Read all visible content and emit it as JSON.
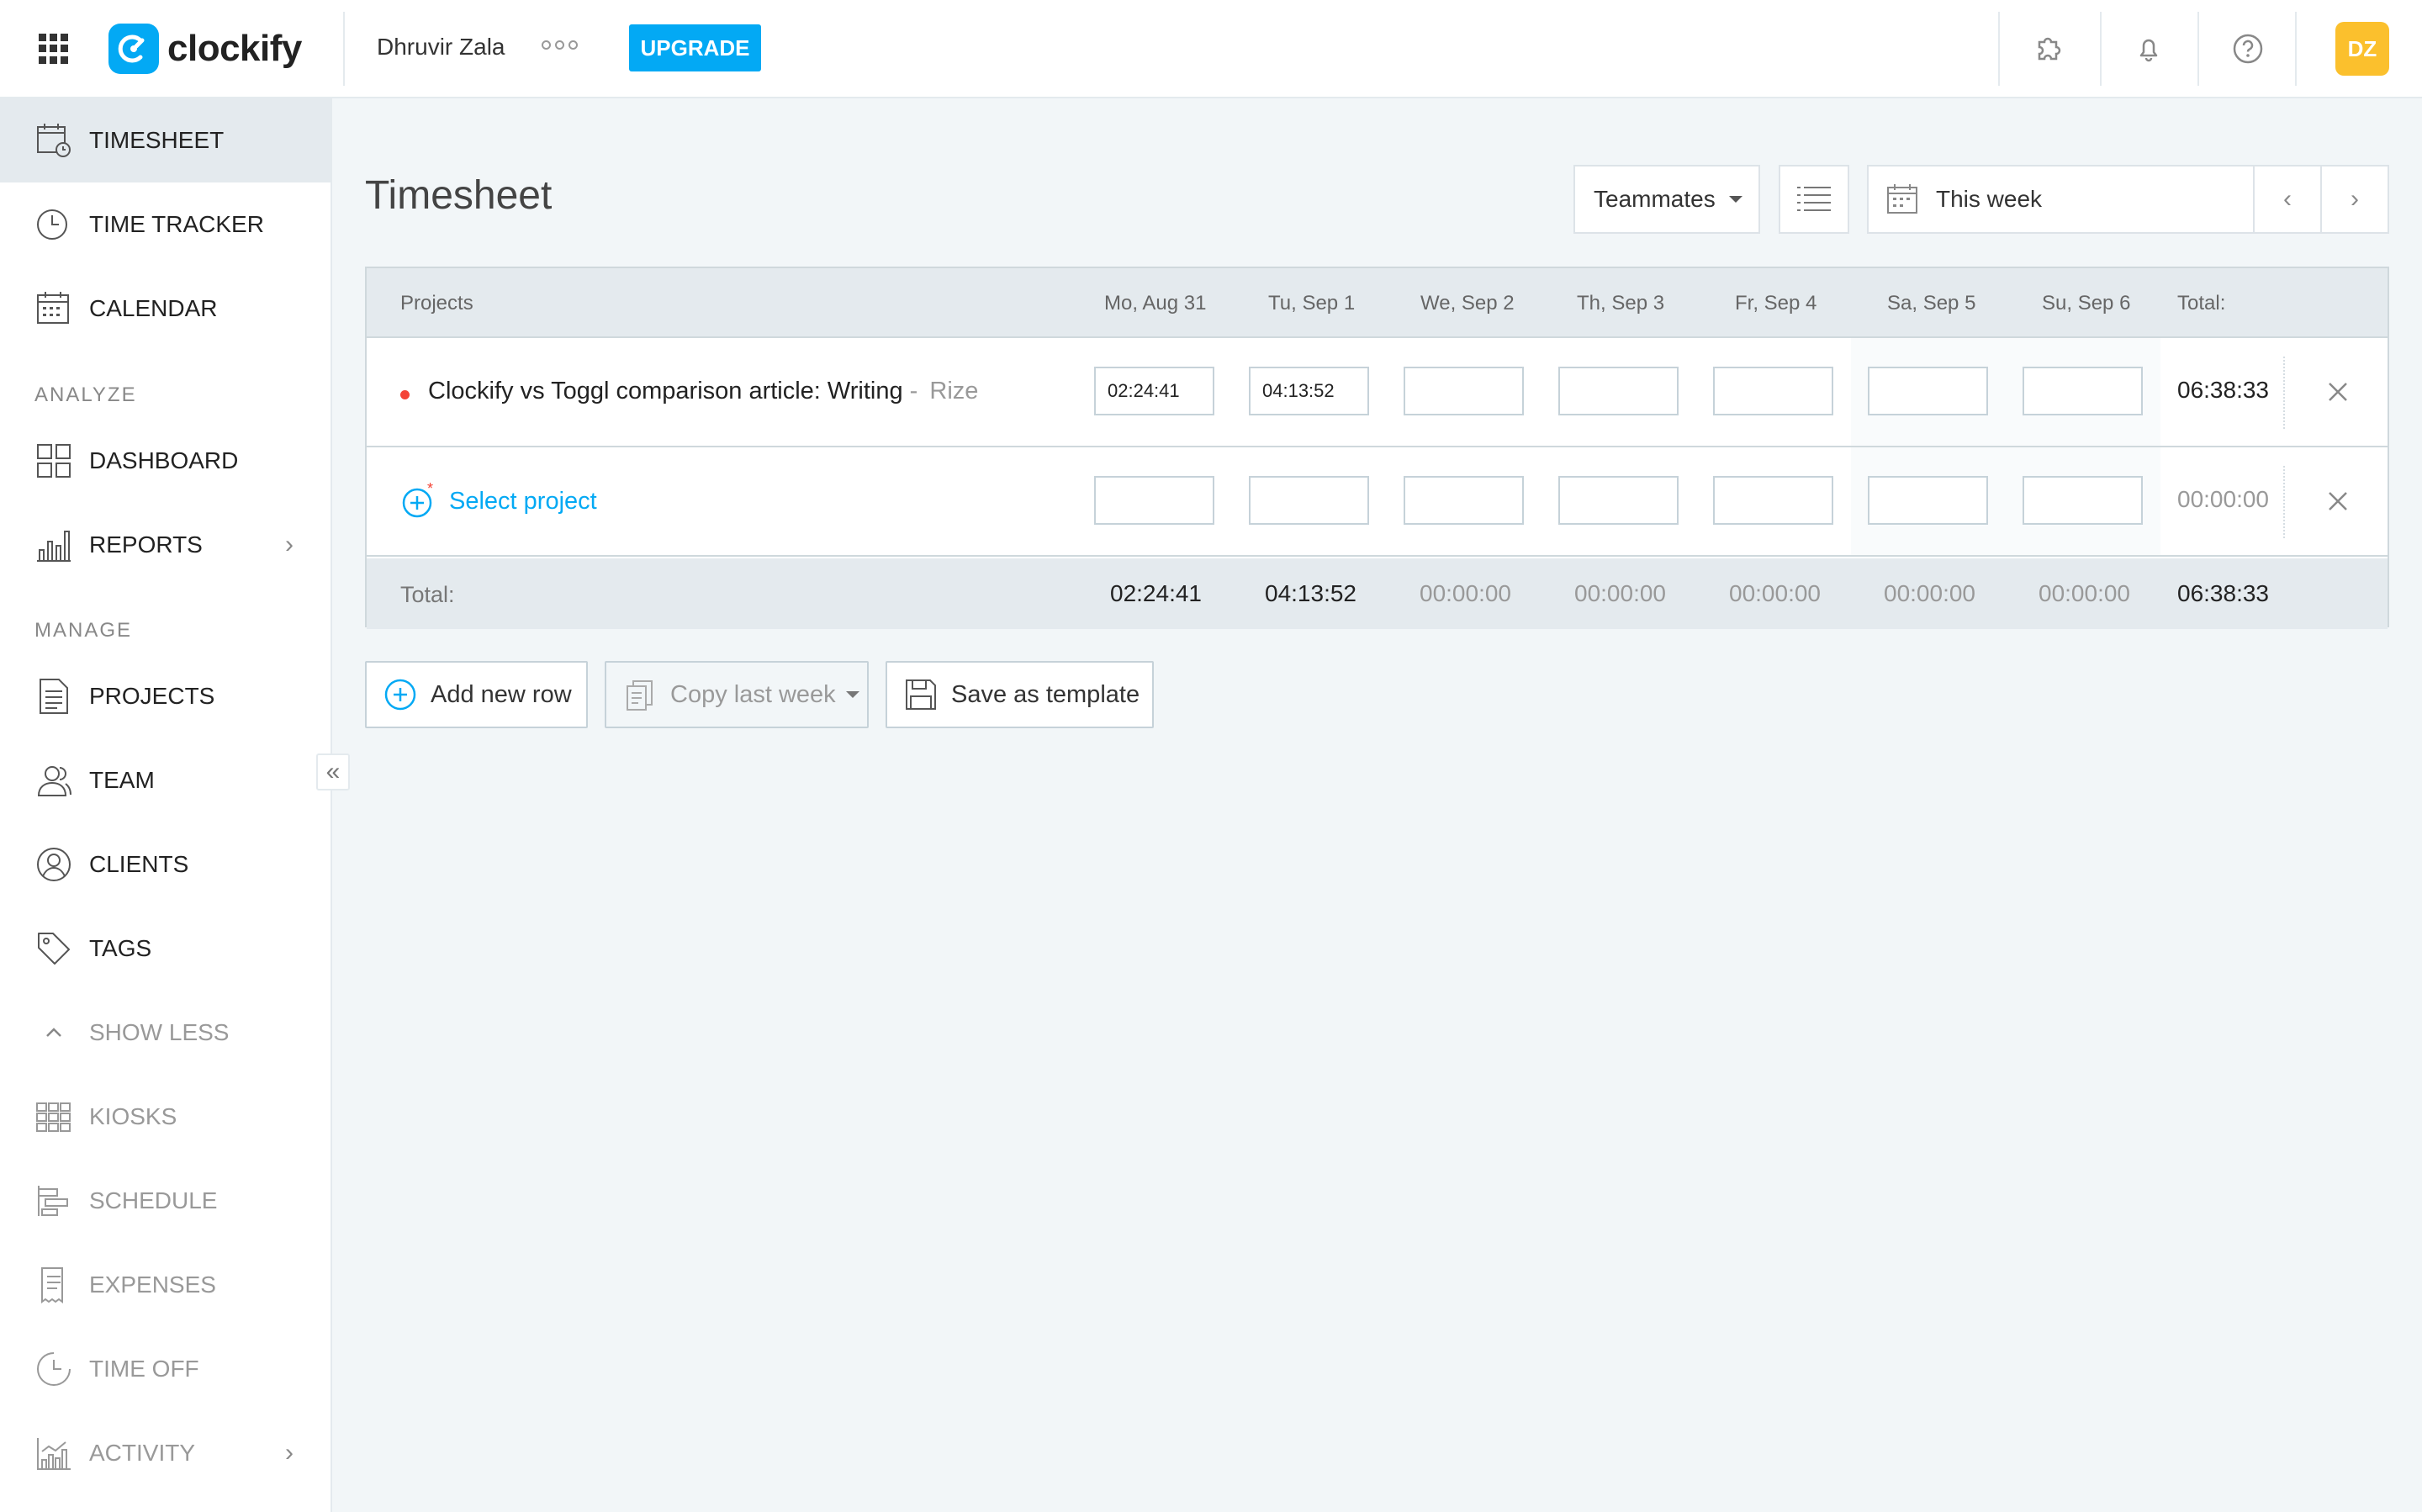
{
  "app": {
    "brand": "clockify",
    "workspace": "Dhruvir Zala",
    "upgrade_label": "UPGRADE",
    "avatar_initials": "DZ",
    "accent_color": "#03a9f4",
    "avatar_color": "#fbc02d"
  },
  "sidebar": {
    "items": [
      {
        "label": "TIMESHEET",
        "icon": "timesheet-icon",
        "active": true
      },
      {
        "label": "TIME TRACKER",
        "icon": "clock-icon"
      },
      {
        "label": "CALENDAR",
        "icon": "calendar-icon"
      },
      {
        "label": "DASHBOARD",
        "icon": "dashboard-icon"
      },
      {
        "label": "REPORTS",
        "icon": "reports-icon"
      },
      {
        "label": "PROJECTS",
        "icon": "projects-icon"
      },
      {
        "label": "TEAM",
        "icon": "team-icon"
      },
      {
        "label": "CLIENTS",
        "icon": "clients-icon"
      },
      {
        "label": "TAGS",
        "icon": "tag-icon"
      },
      {
        "label": "SHOW LESS",
        "icon": "chevron-up-icon"
      },
      {
        "label": "KIOSKS",
        "icon": "kiosk-icon"
      },
      {
        "label": "SCHEDULE",
        "icon": "schedule-icon"
      },
      {
        "label": "EXPENSES",
        "icon": "expenses-icon"
      },
      {
        "label": "TIME OFF",
        "icon": "time-off-icon"
      },
      {
        "label": "ACTIVITY",
        "icon": "activity-icon"
      }
    ],
    "sections": {
      "analyze": "ANALYZE",
      "manage": "MANAGE"
    }
  },
  "page": {
    "title": "Timesheet",
    "teammates_label": "Teammates",
    "range_label": "This week"
  },
  "table": {
    "header_projects": "Projects",
    "days": [
      "Mo, Aug 31",
      "Tu, Sep 1",
      "We, Sep 2",
      "Th, Sep 3",
      "Fr, Sep 4",
      "Sa, Sep 5",
      "Su, Sep 6"
    ],
    "header_total": "Total:",
    "rows": [
      {
        "project": "Clockify vs Toggl comparison article: Writing",
        "separator": " - ",
        "client": "Rize",
        "dot_color": "#f44336",
        "values": [
          "02:24:41",
          "04:13:52",
          "",
          "",
          "",
          "",
          ""
        ],
        "total": "06:38:33"
      }
    ],
    "select_project_label": "Select project",
    "empty_row_total": "00:00:00",
    "totals_label": "Total:",
    "totals": [
      "02:24:41",
      "04:13:52",
      "00:00:00",
      "00:00:00",
      "00:00:00",
      "00:00:00",
      "00:00:00"
    ],
    "grand_total": "06:38:33"
  },
  "actions": {
    "add_row": "Add new row",
    "copy_last_week": "Copy last week",
    "save_template": "Save as template"
  }
}
